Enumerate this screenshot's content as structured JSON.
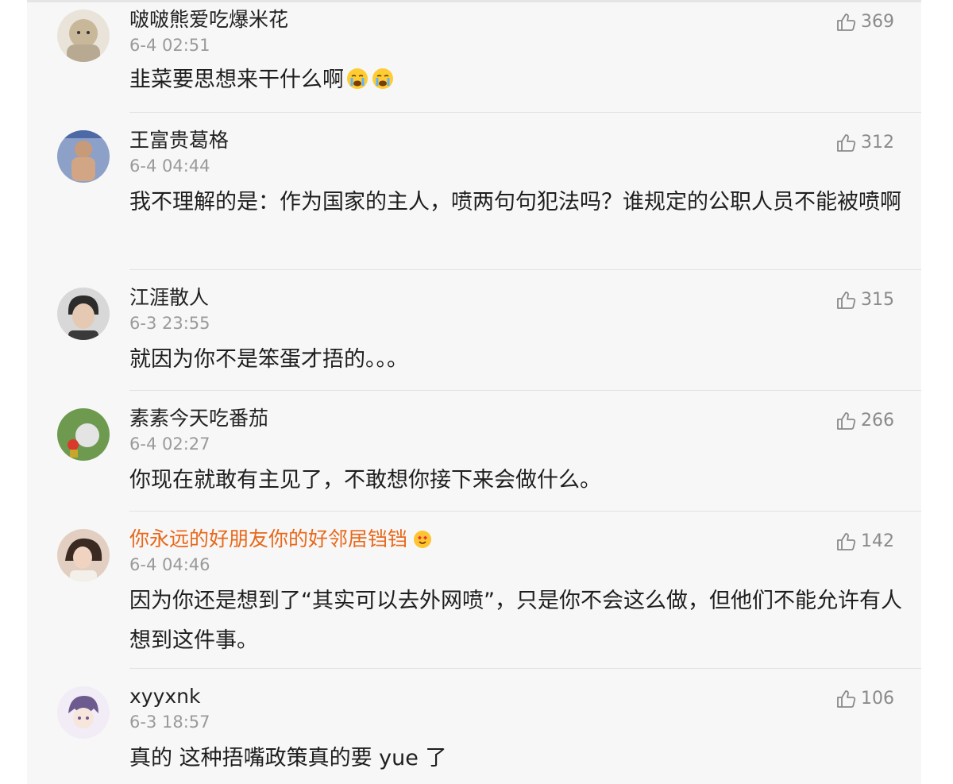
{
  "comments": [
    {
      "username": "啵啵熊爱吃爆米花",
      "time": "6-4 02:51",
      "likes": "369",
      "content": "韭菜要思想来干什么啊",
      "emoji": [
        "crying-emoji",
        "crying-emoji"
      ],
      "avatar_color": "#c9b79a"
    },
    {
      "username": "王富贵葛格",
      "time": "6-4 04:44",
      "likes": "312",
      "content": "我不理解的是：作为国家的主人，喷两句句犯法吗？谁规定的公职人员不能被喷啊",
      "avatar_color": "#7e8fb6"
    },
    {
      "username": "江涯散人",
      "time": "6-3 23:55",
      "likes": "315",
      "content": "就因为你不是笨蛋才捂的。。。",
      "avatar_color": "#6f6f6f"
    },
    {
      "username": "素素今天吃番茄",
      "time": "6-4 02:27",
      "likes": "266",
      "content": "你现在就敢有主见了，不敢想你接下来会做什么。",
      "avatar_color": "#7aa35a"
    },
    {
      "username": "你永远的好朋友你的好邻居铛铛",
      "time": "6-4 04:46",
      "likes": "142",
      "content": "因为你还是想到了“其实可以去外网喷”，只是你不会这么做，但他们不能允许有人想到这件事。",
      "badge": "heart-face-emoji",
      "username_color": "#e8681a",
      "avatar_color": "#d9b8a8"
    },
    {
      "username": "xyyxnk",
      "time": "6-3 18:57",
      "likes": "106",
      "content": "真的 这种捂嘴政策真的要 yue 了",
      "avatar_color": "#b9a3c9"
    }
  ],
  "icons": {
    "like": "thumbs-up-icon"
  }
}
